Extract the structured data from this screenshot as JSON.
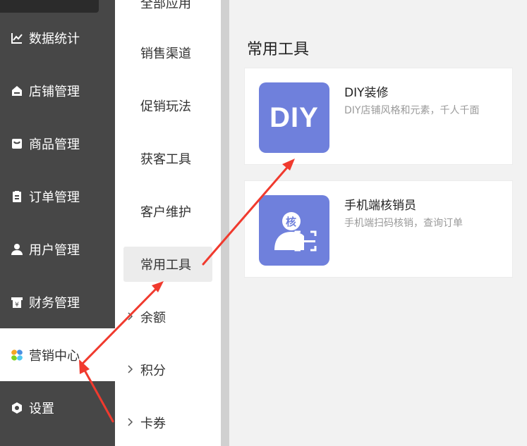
{
  "nav": {
    "items": [
      {
        "label": "数据统计",
        "icon": "chart-icon"
      },
      {
        "label": "店铺管理",
        "icon": "store-icon"
      },
      {
        "label": "商品管理",
        "icon": "product-icon"
      },
      {
        "label": "订单管理",
        "icon": "order-icon"
      },
      {
        "label": "用户管理",
        "icon": "user-icon"
      },
      {
        "label": "财务管理",
        "icon": "finance-icon"
      },
      {
        "label": "营销中心",
        "icon": "marketing-icon",
        "active": true
      },
      {
        "label": "设置",
        "icon": "settings-icon"
      }
    ]
  },
  "subnav": {
    "partial_top_label": "全部应用",
    "items": [
      {
        "label": "销售渠道"
      },
      {
        "label": "促销玩法"
      },
      {
        "label": "获客工具"
      },
      {
        "label": "客户维护"
      },
      {
        "label": "常用工具",
        "active": true
      },
      {
        "label": "余额",
        "collapsible": true
      },
      {
        "label": "积分",
        "collapsible": true
      },
      {
        "label": "卡券",
        "collapsible": true
      }
    ]
  },
  "main": {
    "section_title": "常用工具",
    "cards": [
      {
        "icon_text": "DIY",
        "title": "DIY装修",
        "desc": "DIY店铺风格和元素，千人千面"
      },
      {
        "icon_badge": "核",
        "title": "手机端核销员",
        "desc": "手机端扫码核销，查询订单"
      }
    ]
  },
  "colors": {
    "accent": "#6f80dc",
    "nav_bg": "#474747",
    "arrow": "#f03a2e"
  }
}
